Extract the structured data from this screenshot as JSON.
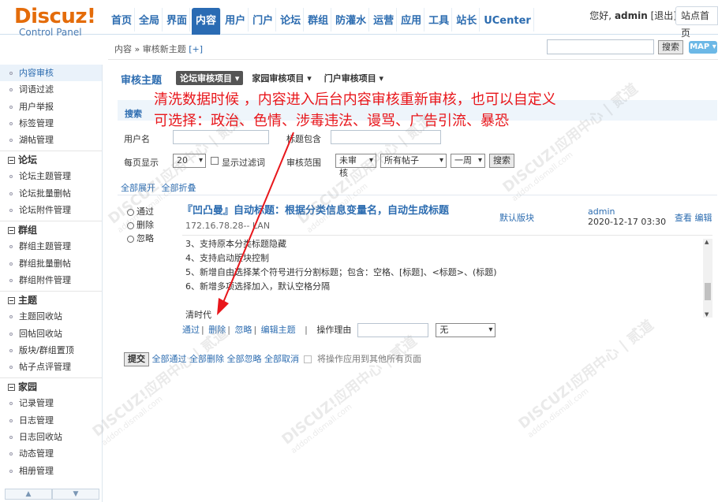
{
  "logo": {
    "brand": "Discuz!",
    "sub": "Control Panel"
  },
  "nav": [
    "首页",
    "全局",
    "界面",
    "内容",
    "用户",
    "门户",
    "论坛",
    "群组",
    "防灌水",
    "运营",
    "应用",
    "工具",
    "站长",
    "UCenter"
  ],
  "nav_active": 3,
  "user": {
    "greeting": "您好,",
    "name": "admin",
    "logout": "[退出]",
    "site_home": "站点首页"
  },
  "breadcrumb": {
    "path": "内容 » 审核新主题",
    "plus": "[+]"
  },
  "top_search": {
    "button": "搜索",
    "map": "MAP ▾"
  },
  "sidebar": {
    "items_a": [
      "内容审核",
      "词语过滤",
      "用户举报",
      "标签管理",
      "湖帖管理"
    ],
    "group_forum": "论坛",
    "items_forum": [
      "论坛主题管理",
      "论坛批量删帖",
      "论坛附件管理"
    ],
    "group_group": "群组",
    "items_group": [
      "群组主题管理",
      "群组批量删帖",
      "群组附件管理"
    ],
    "group_topic": "主题",
    "items_topic": [
      "主题回收站",
      "回帖回收站",
      "版块/群组置顶",
      "帖子点评管理"
    ],
    "group_home": "家园",
    "items_home": [
      "记录管理",
      "日志管理",
      "日志回收站",
      "动态管理",
      "相册管理"
    ],
    "scroll_up": "▲",
    "scroll_down": "▼"
  },
  "main": {
    "title": "审核主题",
    "tabs": [
      "论坛审核项目 ▾",
      "家园审核项目 ▾",
      "门户审核项目 ▾"
    ],
    "search_label": "搜索",
    "username_label": "用户名",
    "title_label": "标题包含",
    "per_page_label": "每页显示",
    "per_page_value": "20",
    "show_filtered_label": "显示过滤词",
    "scope_label": "审核范围",
    "scope_status": "未审核",
    "scope_posts": "所有帖子",
    "scope_period": "一周",
    "search_button": "搜索",
    "expand_all": "全部展开",
    "collapse_all": "全部折叠"
  },
  "entry": {
    "radio_pass": "通过",
    "radio_delete": "删除",
    "radio_ignore": "忽略",
    "title": "『凹凸曼』自动标题：根据分类信息变量名，自动生成标题",
    "ip": "172.16.78.28-- LAN",
    "forum": "默认版块",
    "author": "admin",
    "time": "2020-12-17 03:30",
    "view": "查看",
    "edit": "编辑",
    "lines": [
      "3、支持原本分类标题隐藏",
      "4、支持启动版块控制",
      "5、新增自由选择某个符号进行分割标题；包含：空格、[标题]、<标题>、(标题)",
      "6、新增多项选择加入，默认空格分隔"
    ],
    "extra": "清时代",
    "actions": [
      "通过",
      "删除",
      "忽略",
      "编辑主题"
    ],
    "reason_label": "操作理由",
    "reason_select": "无"
  },
  "bottom": {
    "submit": "提交",
    "links": [
      "全部通过",
      "全部删除",
      "全部忽略",
      "全部取消"
    ],
    "apply_all": "将操作应用到其他所有页面"
  },
  "annotation": {
    "line1": "清洗数据时候 ，内容进入后台内容审核重新审核，也可以自定义",
    "line2": "可选择：政治、色情、涉毒违法、谩骂、广告引流、暴恐",
    "color": "#e8161b"
  },
  "watermark": {
    "main": "DISCUZ!应用中心 | 贰道",
    "sub": "addon.dismall.com"
  }
}
